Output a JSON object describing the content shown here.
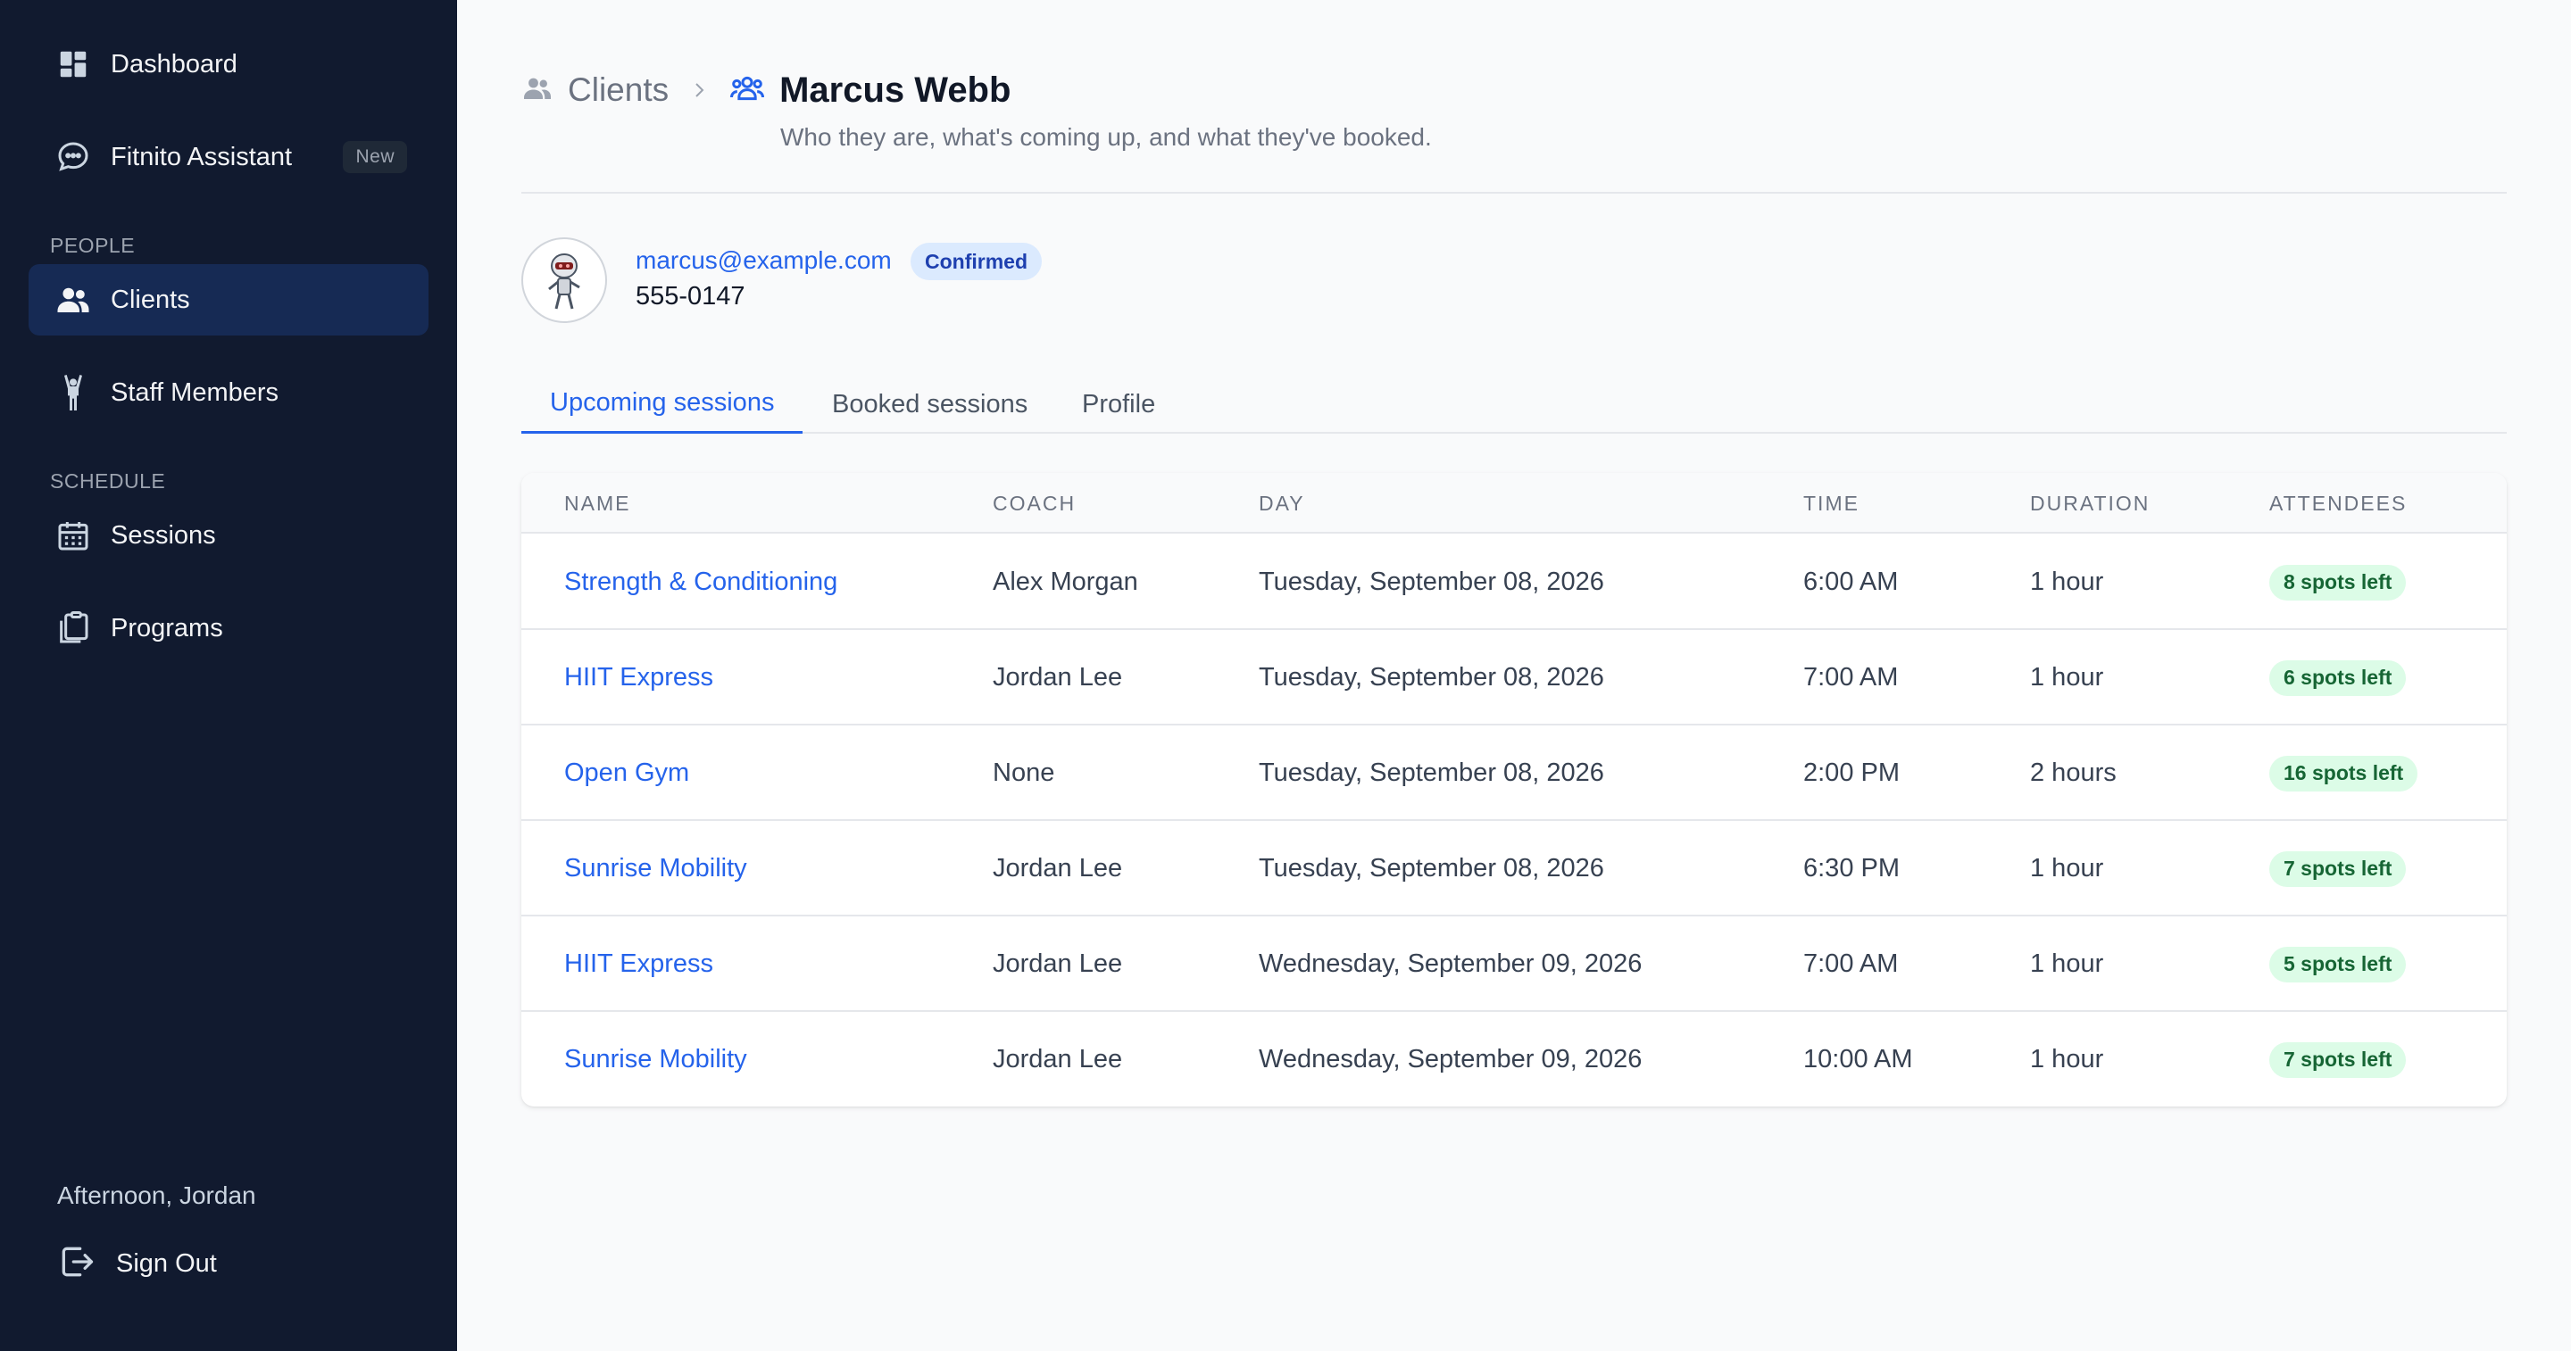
{
  "sidebar": {
    "items": [
      {
        "label": "Dashboard",
        "icon": "dashboard-icon"
      },
      {
        "label": "Fitnito Assistant",
        "icon": "chat-bubble-icon",
        "badge": "New"
      },
      {
        "label": "Clients",
        "icon": "users-icon",
        "active": true
      },
      {
        "label": "Staff Members",
        "icon": "person-arms-up-icon"
      },
      {
        "label": "Sessions",
        "icon": "calendar-icon"
      },
      {
        "label": "Programs",
        "icon": "clipboard-icon"
      }
    ],
    "sections": {
      "people": "PEOPLE",
      "schedule": "SCHEDULE"
    },
    "greeting": "Afternoon, Jordan",
    "signout_label": "Sign Out"
  },
  "header": {
    "breadcrumb_parent": "Clients",
    "title": "Marcus Webb",
    "subtitle": "Who they are, what's coming up, and what they've booked."
  },
  "client": {
    "email": "marcus@example.com",
    "status": "Confirmed",
    "phone": "555-0147"
  },
  "tabs": [
    {
      "label": "Upcoming sessions",
      "active": true
    },
    {
      "label": "Booked sessions"
    },
    {
      "label": "Profile"
    }
  ],
  "table": {
    "headers": [
      "NAME",
      "COACH",
      "DAY",
      "TIME",
      "DURATION",
      "ATTENDEES"
    ],
    "rows": [
      {
        "name": "Strength & Conditioning",
        "coach": "Alex Morgan",
        "day": "Tuesday, September 08, 2026",
        "time": "6:00 AM",
        "duration": "1 hour",
        "attendees": "8 spots left"
      },
      {
        "name": "HIIT Express",
        "coach": "Jordan Lee",
        "day": "Tuesday, September 08, 2026",
        "time": "7:00 AM",
        "duration": "1 hour",
        "attendees": "6 spots left"
      },
      {
        "name": "Open Gym",
        "coach": "None",
        "day": "Tuesday, September 08, 2026",
        "time": "2:00 PM",
        "duration": "2 hours",
        "attendees": "16 spots left"
      },
      {
        "name": "Sunrise Mobility",
        "coach": "Jordan Lee",
        "day": "Tuesday, September 08, 2026",
        "time": "6:30 PM",
        "duration": "1 hour",
        "attendees": "7 spots left"
      },
      {
        "name": "HIIT Express",
        "coach": "Jordan Lee",
        "day": "Wednesday, September 09, 2026",
        "time": "7:00 AM",
        "duration": "1 hour",
        "attendees": "5 spots left"
      },
      {
        "name": "Sunrise Mobility",
        "coach": "Jordan Lee",
        "day": "Wednesday, September 09, 2026",
        "time": "10:00 AM",
        "duration": "1 hour",
        "attendees": "7 spots left"
      }
    ]
  },
  "colors": {
    "sidebar_bg": "#111a2f",
    "active_nav": "#162a54",
    "accent": "#2563eb",
    "spots_bg": "#dcfce7",
    "spots_text": "#166534"
  }
}
